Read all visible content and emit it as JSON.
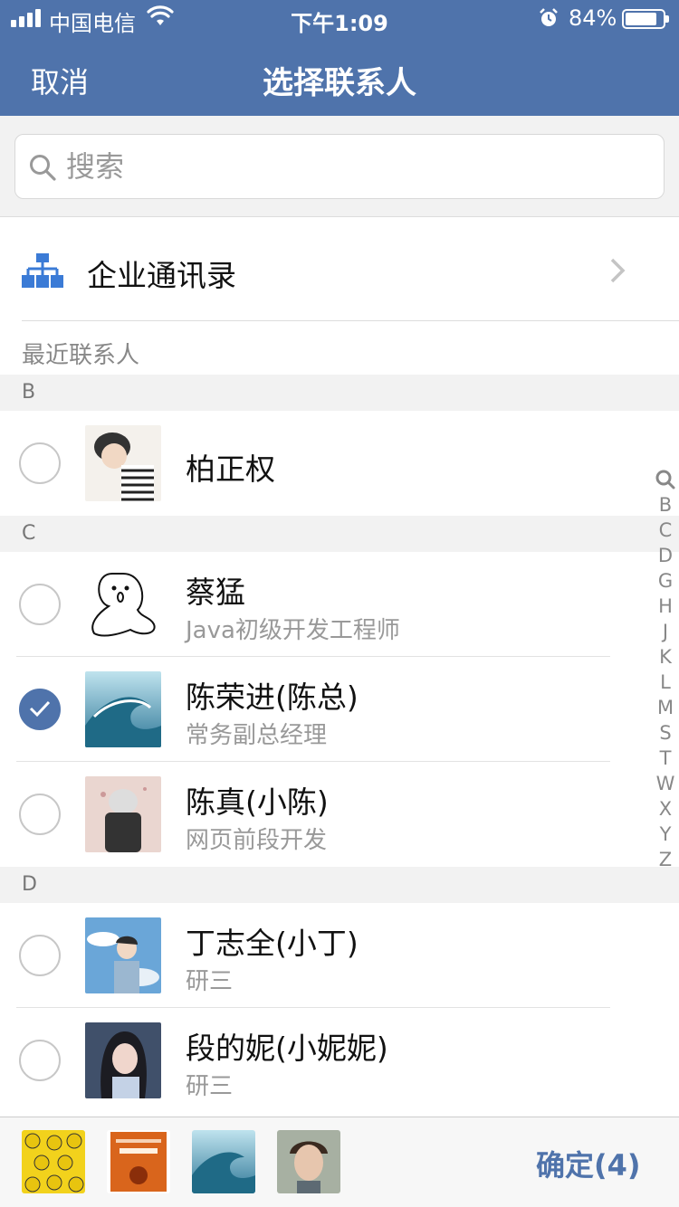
{
  "status_bar": {
    "carrier": "中国电信",
    "time": "下午1:09",
    "battery": "84%"
  },
  "nav": {
    "cancel": "取消",
    "title": "选择联系人"
  },
  "search": {
    "placeholder": "搜索"
  },
  "enterprise": {
    "label": "企业通讯录"
  },
  "recent_label": "最近联系人",
  "sections": {
    "b": "B",
    "c": "C",
    "d": "D"
  },
  "contacts": [
    {
      "name": "柏正权",
      "role": "",
      "checked": false
    },
    {
      "name": "蔡猛",
      "role": "Java初级开发工程师",
      "checked": false
    },
    {
      "name": "陈荣进(陈总)",
      "role": "常务副总经理",
      "checked": true
    },
    {
      "name": "陈真(小陈)",
      "role": "网页前段开发",
      "checked": false
    },
    {
      "name": "丁志全(小丁)",
      "role": "研三",
      "checked": false
    },
    {
      "name": "段的妮(小妮妮)",
      "role": "研三",
      "checked": false
    }
  ],
  "index_letters": [
    "B",
    "C",
    "D",
    "G",
    "H",
    "J",
    "K",
    "L",
    "M",
    "S",
    "T",
    "W",
    "X",
    "Y",
    "Z"
  ],
  "bottom": {
    "confirm": "确定(4)"
  },
  "colors": {
    "accent": "#4f73ab"
  }
}
